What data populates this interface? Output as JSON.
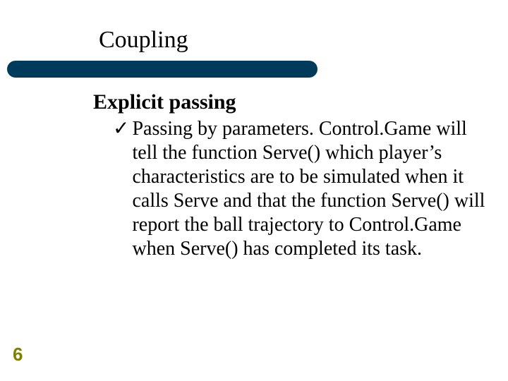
{
  "title": "Coupling",
  "subheading": "Explicit passing",
  "bullet_check": "✓",
  "body_text": "Passing by parameters. Control.Game will tell the function Serve() which player’s characteristics are to be simulated when it calls Serve and that the function Serve() will report the ball trajectory to Control.Game when Serve() has completed its task.",
  "page_number": "6",
  "colors": {
    "divider": "#003b5c",
    "page_number": "#808000"
  }
}
